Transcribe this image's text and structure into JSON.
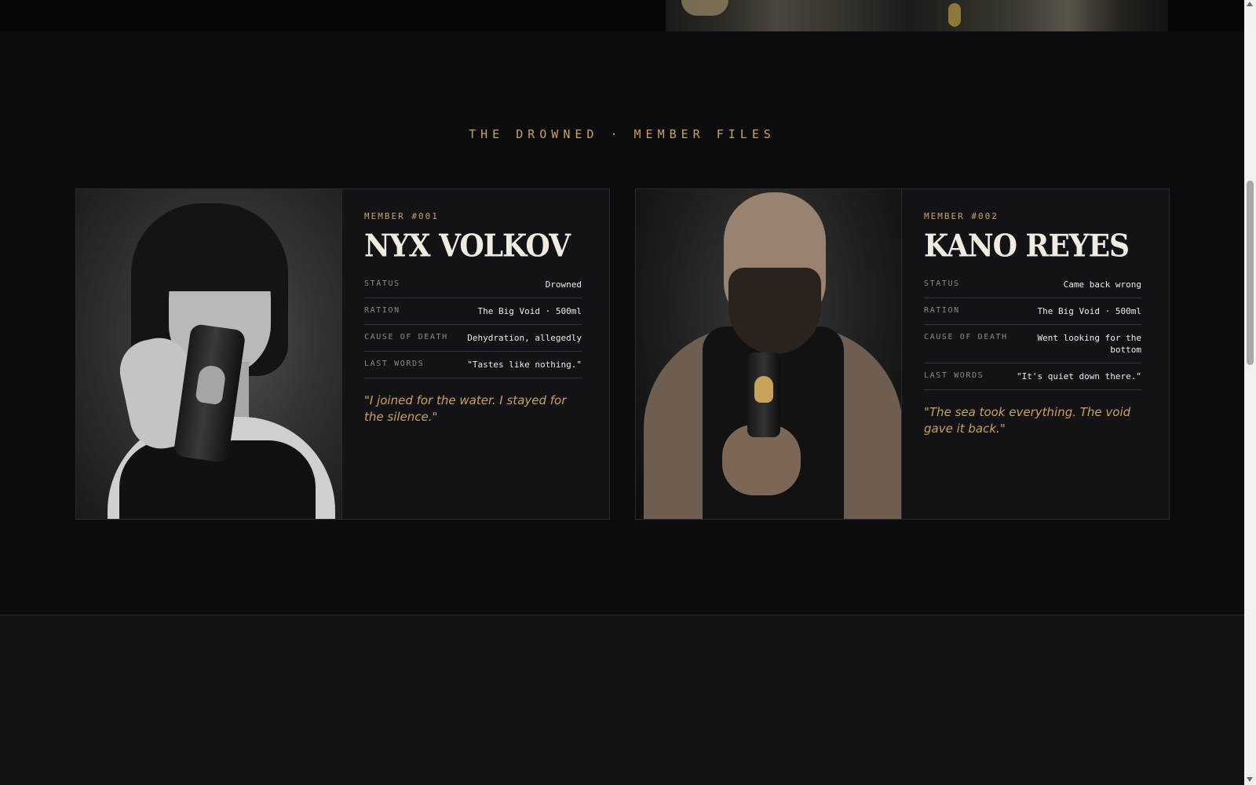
{
  "section": {
    "title": "THE DROWNED · MEMBER FILES"
  },
  "members": [
    {
      "number": "MEMBER #001",
      "name": "NYX VOLKOV",
      "rows": [
        {
          "key": "STATUS",
          "value": "Drowned"
        },
        {
          "key": "RATION",
          "value": "The Big Void · 500ml"
        },
        {
          "key": "CAUSE OF DEATH",
          "value": "Dehydration, allegedly"
        },
        {
          "key": "LAST WORDS",
          "value": "\"Tastes like nothing.\""
        }
      ],
      "quote": "\"I joined for the water. I stayed for the silence.\""
    },
    {
      "number": "MEMBER #002",
      "name": "KANO REYES",
      "rows": [
        {
          "key": "STATUS",
          "value": "Came back wrong"
        },
        {
          "key": "RATION",
          "value": "The Big Void · 500ml"
        },
        {
          "key": "CAUSE OF DEATH",
          "value": "Went looking for the bottom"
        },
        {
          "key": "LAST WORDS",
          "value": "\"It's quiet down there.\""
        }
      ],
      "quote": "\"The sea took everything. The void gave it back.\""
    }
  ],
  "colors": {
    "accent": "#c9a25c",
    "background": "#0c0c0f",
    "card": "#131317"
  }
}
